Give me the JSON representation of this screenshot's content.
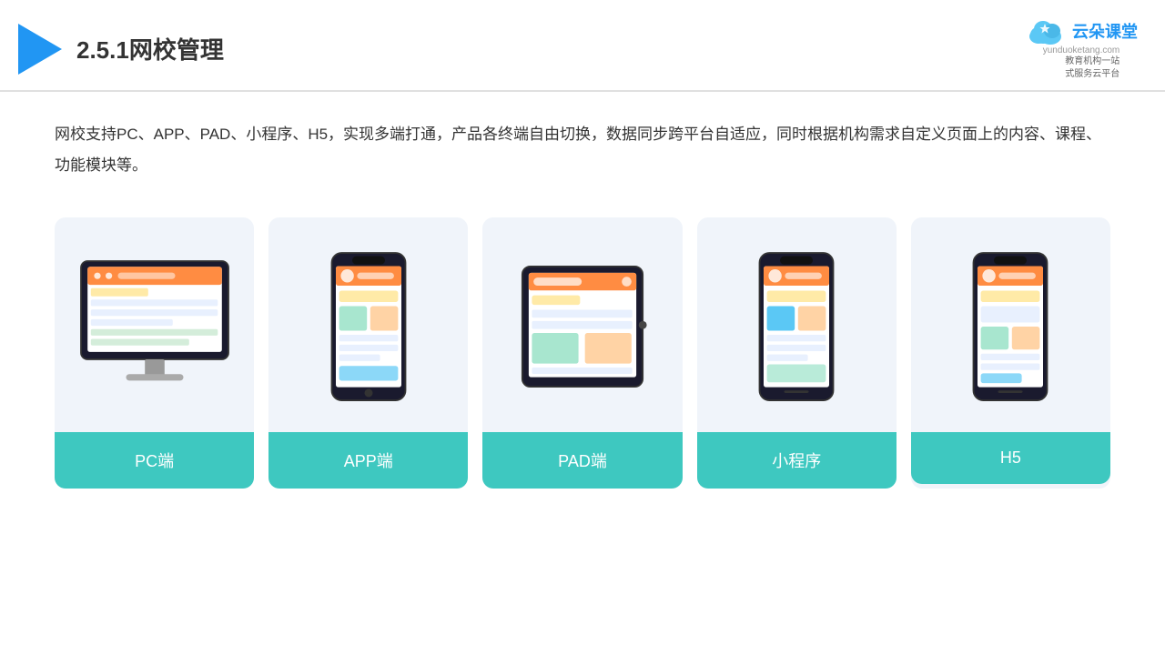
{
  "header": {
    "title": "2.5.1网校管理",
    "logo_name": "云朵课堂",
    "logo_domain": "yunduoketang.com",
    "logo_subtitle_line1": "教育机构一站",
    "logo_subtitle_line2": "式服务云平台"
  },
  "description": "网校支持PC、APP、PAD、小程序、H5，实现多端打通，产品各终端自由切换，数据同步跨平台自适应，同时根据机构需求自定义页面上的内容、课程、功能模块等。",
  "cards": [
    {
      "id": "pc",
      "label": "PC端"
    },
    {
      "id": "app",
      "label": "APP端"
    },
    {
      "id": "pad",
      "label": "PAD端"
    },
    {
      "id": "miniapp",
      "label": "小程序"
    },
    {
      "id": "h5",
      "label": "H5"
    }
  ],
  "colors": {
    "card_bg": "#eef2f8",
    "card_label_bg": "#3ec8c0",
    "accent_blue": "#2196f3",
    "title_color": "#333333"
  }
}
